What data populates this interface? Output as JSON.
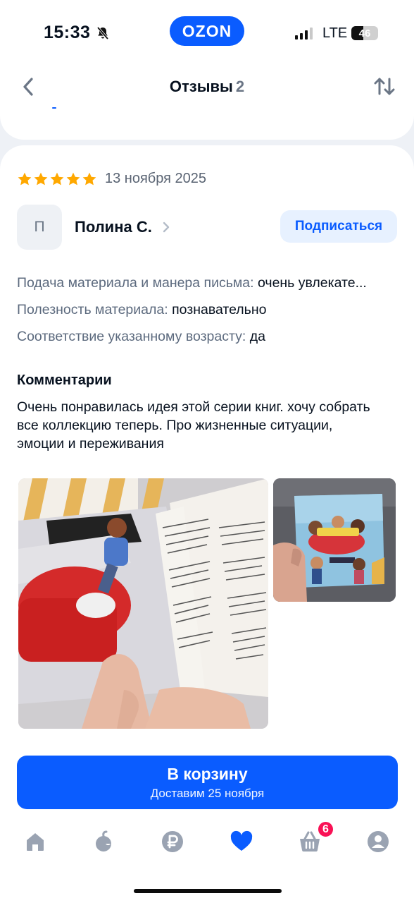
{
  "status_bar": {
    "time": "15:33",
    "brand": "OZON",
    "network": "LTE",
    "battery": "46",
    "battery_level": 0.46
  },
  "header": {
    "title": "Отзывы",
    "count": "2",
    "back_icon": "chevron-left-icon",
    "sort_icon": "sort-arrows-icon"
  },
  "review": {
    "rating": 5,
    "date": "13 ноября 2025",
    "author": {
      "initial": "П",
      "name": "Полина С."
    },
    "subscribe_label": "Подписаться",
    "params": [
      {
        "key": "Подача материала и манера письма:",
        "value": " очень увлекате..."
      },
      {
        "key": "Полезность материала:",
        "value": " познавательно"
      },
      {
        "key": "Соответствие указанному возрасту:",
        "value": " да"
      }
    ],
    "comments_heading": "Комментарии",
    "comment": "Очень понравилась идея этой серии книг. хочу собрать все коллекцию теперь. Про жизненные ситуации, эмоции и переживания"
  },
  "cart": {
    "label": "В корзину",
    "sublabel": "Доставим 25 ноября"
  },
  "nav": {
    "items": [
      "home-icon",
      "fresh-icon",
      "ruble-icon",
      "favorites-icon",
      "cart-icon",
      "profile-icon"
    ],
    "cart_badge": "6",
    "active_color": "#0a5cff",
    "inactive_color": "#9aa3b2"
  },
  "colors": {
    "accent": "#0a5cff",
    "star": "#ffa800",
    "badge": "#f91155"
  }
}
